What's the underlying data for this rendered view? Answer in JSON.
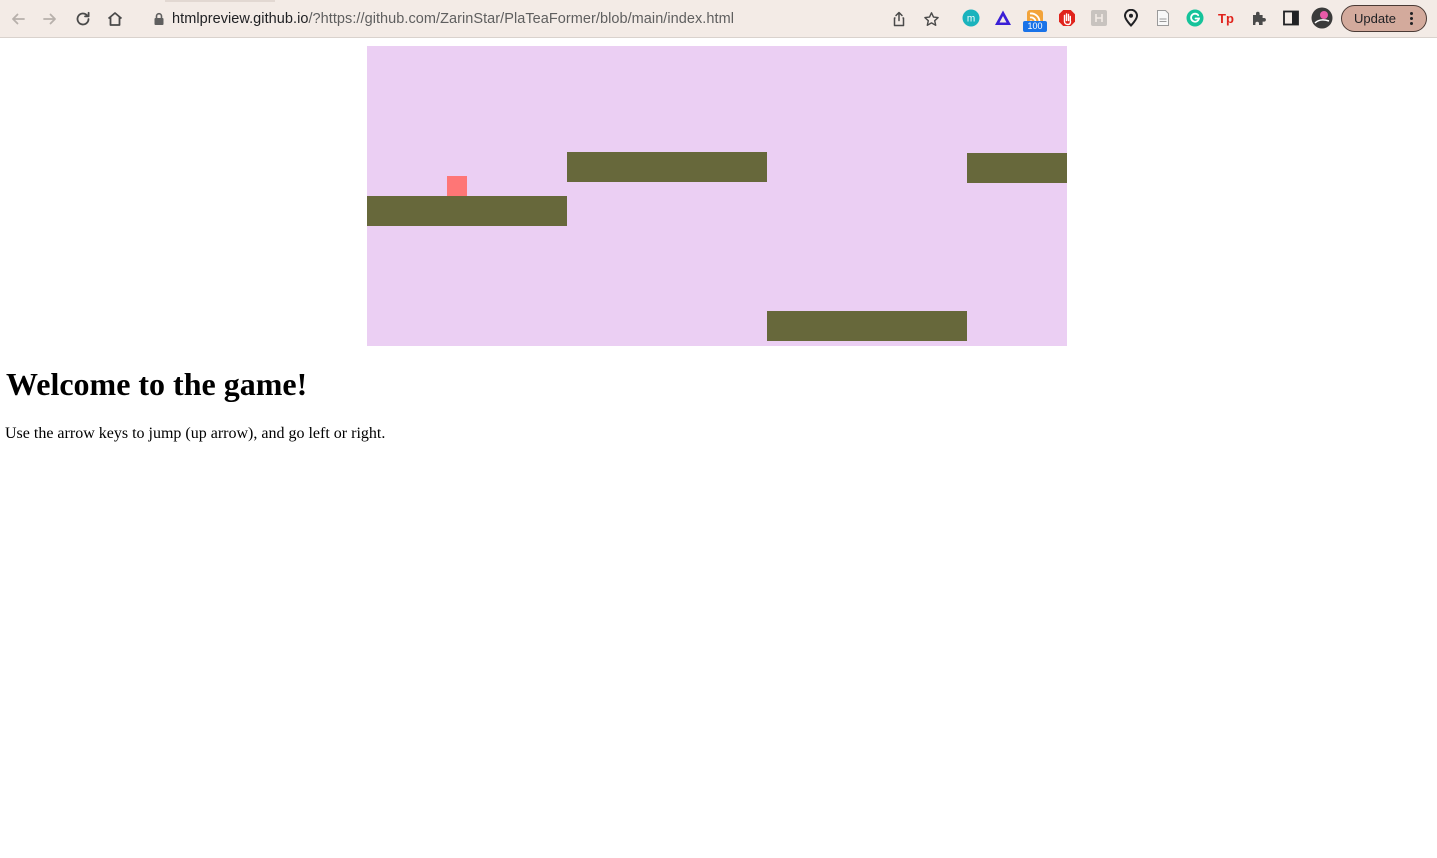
{
  "browser": {
    "url_host": "htmlpreview.github.io",
    "url_path": "/?https://github.com/ZarinStar/PlaTeaFormer/blob/main/index.html",
    "extension_badge": "100",
    "update_label": "Update"
  },
  "page": {
    "heading": "Welcome to the game!",
    "instructions": "Use the arrow keys to jump (up arrow), and go left or right."
  },
  "game": {
    "background_color": "#ebcff3",
    "platform_color": "#67683b",
    "player_color": "#fe7676"
  }
}
